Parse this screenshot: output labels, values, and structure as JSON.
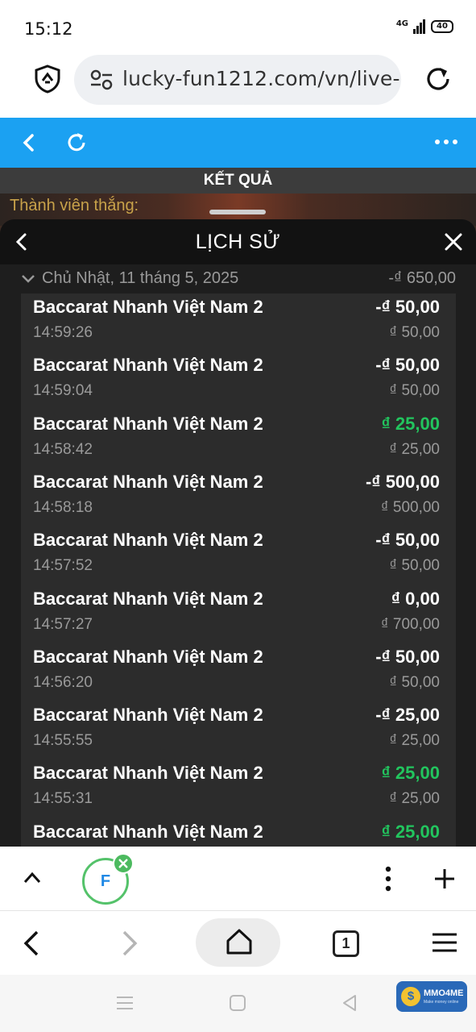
{
  "status_bar": {
    "time": "15:12",
    "network": "4G",
    "battery": "40"
  },
  "browser": {
    "url": "lucky-fun1212.com/vn/live-ca",
    "tab_count": "1",
    "tab_avatar_letter": "F"
  },
  "game": {
    "result_label": "KẾT QUẢ",
    "winners_label": "Thành viên thắng:"
  },
  "history": {
    "title": "LỊCH SỬ",
    "date": "Chủ Nhật, 11 tháng 5, 2025",
    "date_total": "-₫ 650,00",
    "rows": [
      {
        "game": "Baccarat Nhanh Việt Nam 2",
        "time": "14:59:26",
        "amount": "-₫ 50,00",
        "bet": "₫ 50,00",
        "win": false
      },
      {
        "game": "Baccarat Nhanh Việt Nam 2",
        "time": "14:59:04",
        "amount": "-₫ 50,00",
        "bet": "₫ 50,00",
        "win": false
      },
      {
        "game": "Baccarat Nhanh Việt Nam 2",
        "time": "14:58:42",
        "amount": "₫ 25,00",
        "bet": "₫ 25,00",
        "win": true
      },
      {
        "game": "Baccarat Nhanh Việt Nam 2",
        "time": "14:58:18",
        "amount": "-₫ 500,00",
        "bet": "₫ 500,00",
        "win": false
      },
      {
        "game": "Baccarat Nhanh Việt Nam 2",
        "time": "14:57:52",
        "amount": "-₫ 50,00",
        "bet": "₫ 50,00",
        "win": false
      },
      {
        "game": "Baccarat Nhanh Việt Nam 2",
        "time": "14:57:27",
        "amount": "₫ 0,00",
        "bet": "₫ 700,00",
        "win": false
      },
      {
        "game": "Baccarat Nhanh Việt Nam 2",
        "time": "14:56:20",
        "amount": "-₫ 50,00",
        "bet": "₫ 50,00",
        "win": false
      },
      {
        "game": "Baccarat Nhanh Việt Nam 2",
        "time": "14:55:55",
        "amount": "-₫ 25,00",
        "bet": "₫ 25,00",
        "win": false
      },
      {
        "game": "Baccarat Nhanh Việt Nam 2",
        "time": "14:55:31",
        "amount": "₫ 25,00",
        "bet": "₫ 25,00",
        "win": true
      },
      {
        "game": "Baccarat Nhanh Việt Nam 2",
        "time": "",
        "amount": "₫ 25,00",
        "bet": "",
        "win": true
      }
    ]
  },
  "watermark": {
    "text": "MMO4ME",
    "subtext": "Make money online",
    "coin": "$"
  },
  "colors": {
    "toolbar_blue": "#1ba1f2",
    "win_green": "#22c55e",
    "loss_white": "#ffffff",
    "panel_bg": "#1e1e1e",
    "list_bg": "#2c2c2c"
  },
  "icons": [
    "shield-icon",
    "site-settings-icon",
    "reload-icon",
    "back-arrow-icon",
    "refresh-icon",
    "more-dots-icon",
    "close-icon",
    "chevron-down-icon",
    "chevron-up-icon",
    "plus-icon",
    "home-icon",
    "hamburger-icon"
  ]
}
